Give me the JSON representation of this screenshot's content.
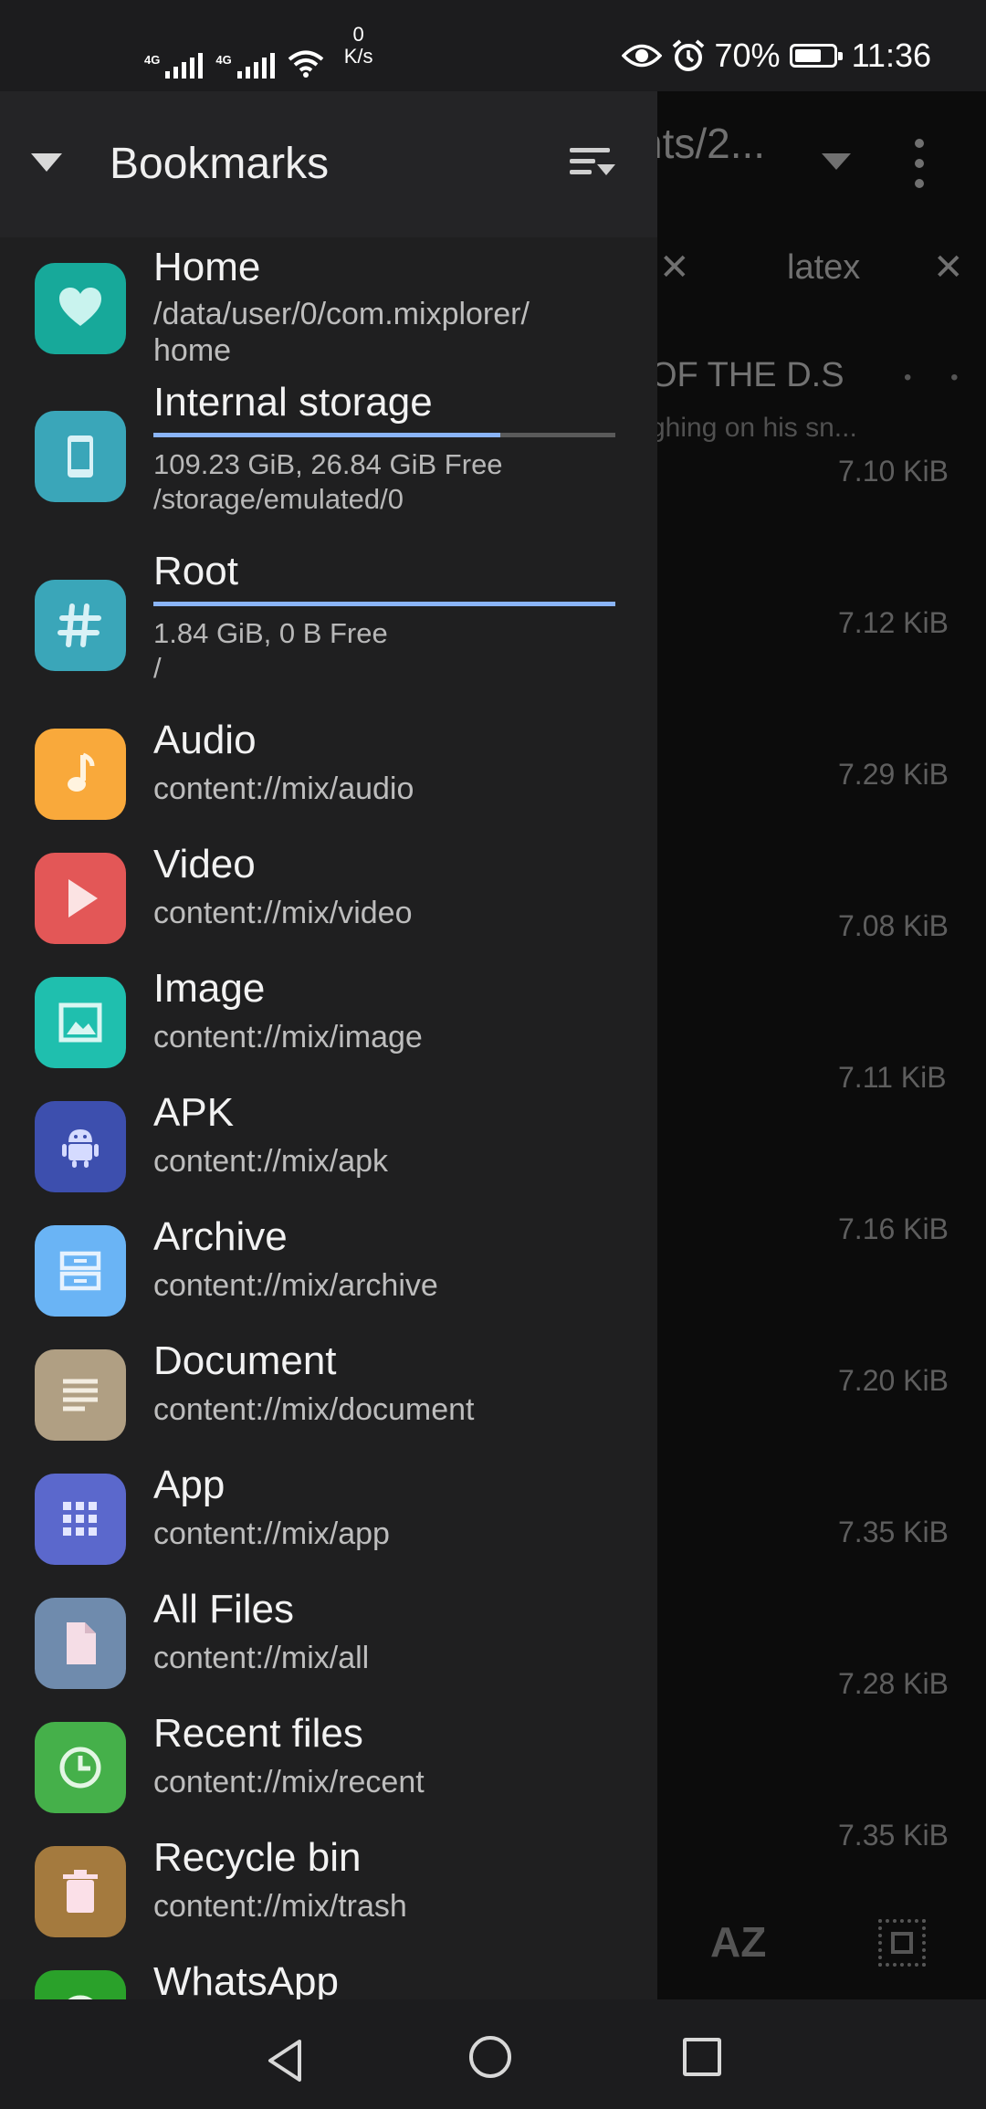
{
  "status_bar": {
    "network1": "4G",
    "network2": "4G",
    "net_speed_value": "0",
    "net_speed_unit": "K/s",
    "battery_percent": "70%",
    "battery_level": 0.7,
    "time": "11:36"
  },
  "background": {
    "path_label": "nts/2...",
    "tab_label": "latex",
    "folder_title": "OF THE D.S",
    "folder_subtitle": "ghing on his sn...",
    "sizes": [
      {
        "value": "7.10",
        "unit": "KiB"
      },
      {
        "value": "7.12",
        "unit": "KiB"
      },
      {
        "value": "7.29",
        "unit": "KiB"
      },
      {
        "value": "7.08",
        "unit": "KiB"
      },
      {
        "value": "7.11",
        "unit": "KiB"
      },
      {
        "value": "7.16",
        "unit": "KiB"
      },
      {
        "value": "7.20",
        "unit": "KiB"
      },
      {
        "value": "7.35",
        "unit": "KiB"
      },
      {
        "value": "7.28",
        "unit": "KiB"
      },
      {
        "value": "7.35",
        "unit": "KiB"
      }
    ],
    "sort_label": "AZ"
  },
  "drawer": {
    "title": "Bookmarks",
    "items": [
      {
        "title": "Home",
        "subtitle": "/data/user/0/com.mixplorer/\nhome",
        "icon": "heart-icon",
        "color": "#17a99a"
      },
      {
        "title": "Internal storage",
        "storage": "109.23 GiB,  26.84 GiB Free",
        "subtitle": "/storage/emulated/0",
        "icon": "phone-icon",
        "color": "#3aa6b9",
        "usage": 0.75
      },
      {
        "title": "Root",
        "storage": "1.84 GiB,  0 B Free",
        "subtitle": "/",
        "icon": "hash-icon",
        "color": "#3aa6b9",
        "usage": 1.0
      },
      {
        "title": "Audio",
        "subtitle": "content://mix/audio",
        "icon": "music-note-icon",
        "color": "#f9a93b"
      },
      {
        "title": "Video",
        "subtitle": "content://mix/video",
        "icon": "play-icon",
        "color": "#e35757"
      },
      {
        "title": "Image",
        "subtitle": "content://mix/image",
        "icon": "image-icon",
        "color": "#1fbfae"
      },
      {
        "title": "APK",
        "subtitle": "content://mix/apk",
        "icon": "android-icon",
        "color": "#3d4fae"
      },
      {
        "title": "Archive",
        "subtitle": "content://mix/archive",
        "icon": "archive-icon",
        "color": "#6ab4f5"
      },
      {
        "title": "Document",
        "subtitle": "content://mix/document",
        "icon": "document-icon",
        "color": "#b09f83"
      },
      {
        "title": "App",
        "subtitle": "content://mix/app",
        "icon": "apps-grid-icon",
        "color": "#5b68cc"
      },
      {
        "title": "All Files",
        "subtitle": "content://mix/all",
        "icon": "file-icon",
        "color": "#6f8bad"
      },
      {
        "title": "Recent files",
        "subtitle": "content://mix/recent",
        "icon": "clock-icon",
        "color": "#45b04a"
      },
      {
        "title": "Recycle bin",
        "subtitle": "content://mix/trash",
        "icon": "trash-icon",
        "color": "#a47a3e"
      },
      {
        "title": "WhatsApp",
        "subtitle": "",
        "icon": "whatsapp-icon",
        "color": "#2aa12a"
      }
    ]
  }
}
